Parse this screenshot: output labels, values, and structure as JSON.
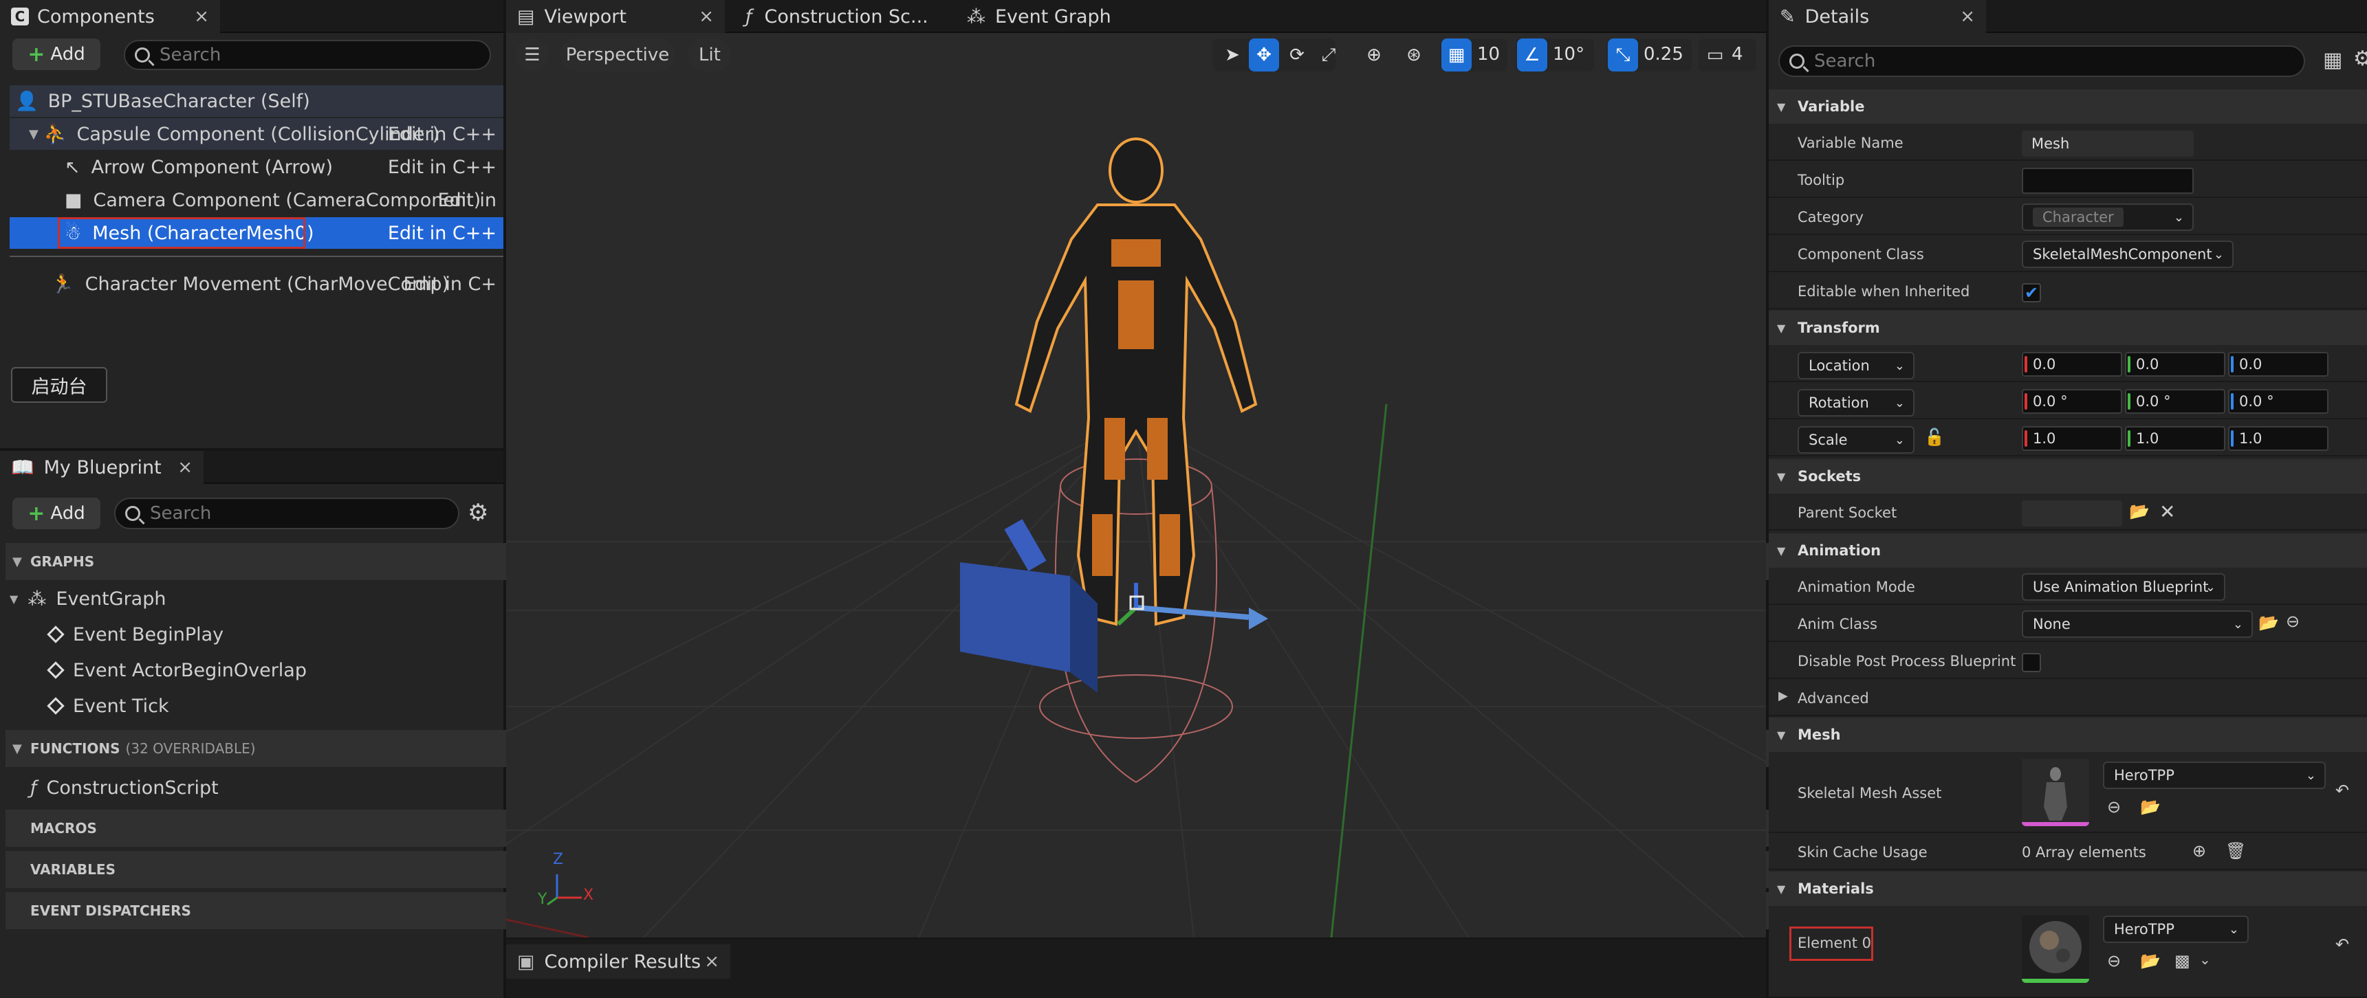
{
  "components_panel": {
    "tab_title": "Components",
    "tab_close": "×",
    "add_label": "Add",
    "search_placeholder": "Search",
    "tree": [
      {
        "label": "BP_STUBaseCharacter (Self)",
        "edit": ""
      },
      {
        "label": "Capsule Component (CollisionCylinder)",
        "edit": "Edit in C++"
      },
      {
        "label": "Arrow Component (Arrow)",
        "edit": "Edit in C++"
      },
      {
        "label": "Camera Component (CameraComponent)",
        "edit": "Edit in"
      },
      {
        "label": "Mesh (CharacterMesh0)",
        "edit": "Edit in C++"
      },
      {
        "label": "Character Movement (CharMoveComp)",
        "edit": "Edit in C+"
      }
    ],
    "launchpad_label": "启动台"
  },
  "my_blueprint": {
    "tab_title": "My Blueprint",
    "tab_close": "×",
    "add_label": "Add",
    "search_placeholder": "Search",
    "sections": {
      "graphs": "GRAPHS",
      "functions": "FUNCTIONS",
      "functions_count": "(32 OVERRIDABLE)",
      "macros": "MACROS",
      "variables": "VARIABLES",
      "event_dispatchers": "EVENT DISPATCHERS"
    },
    "graph_name": "EventGraph",
    "events": [
      "Event BeginPlay",
      "Event ActorBeginOverlap",
      "Event Tick"
    ],
    "function_name": "ConstructionScript"
  },
  "editor_tabs": [
    {
      "label": "Viewport",
      "close": "×"
    },
    {
      "label": "Construction Sc...",
      "close": ""
    },
    {
      "label": "Event Graph",
      "close": ""
    }
  ],
  "viewport": {
    "perspective_label": "Perspective",
    "lit_label": "Lit",
    "grid_snap": "10",
    "rotation_snap": "10°",
    "scale_snap": "0.25",
    "camera_speed": "4",
    "axis_labels": {
      "z": "Z",
      "y": "Y",
      "x": "X"
    }
  },
  "compiler_results": {
    "tab_title": "Compiler Results",
    "close": "×"
  },
  "details": {
    "tab_title": "Details",
    "tab_close": "×",
    "search_placeholder": "Search",
    "variable_section": "Variable",
    "variable_name_label": "Variable Name",
    "variable_name_value": "Mesh",
    "tooltip_label": "Tooltip",
    "tooltip_value": "",
    "category_label": "Category",
    "category_value": "Character",
    "component_class_label": "Component Class",
    "component_class_value": "SkeletalMeshComponent",
    "editable_label": "Editable when Inherited",
    "editable_checked": true,
    "transform_section": "Transform",
    "location_label": "Location",
    "location": [
      "0.0",
      "0.0",
      "0.0"
    ],
    "rotation_label": "Rotation",
    "rotation": [
      "0.0 °",
      "0.0 °",
      "0.0 °"
    ],
    "scale_label": "Scale",
    "scale": [
      "1.0",
      "1.0",
      "1.0"
    ],
    "sockets_section": "Sockets",
    "parent_socket_label": "Parent Socket",
    "animation_section": "Animation",
    "animation_mode_label": "Animation Mode",
    "animation_mode_value": "Use Animation Blueprint",
    "anim_class_label": "Anim Class",
    "anim_class_value": "None",
    "disable_ppb_label": "Disable Post Process Blueprint",
    "advanced_label": "Advanced",
    "mesh_section": "Mesh",
    "skeletal_mesh_label": "Skeletal Mesh Asset",
    "skeletal_mesh_value": "HeroTPP",
    "skin_cache_label": "Skin Cache Usage",
    "skin_cache_value": "0 Array elements",
    "materials_section": "Materials",
    "element0_label": "Element 0",
    "element0_value": "HeroTPP"
  },
  "colors": {
    "selection": "#2166d6",
    "highlight_box": "#c8302c",
    "accent_blue": "#1d6fd6",
    "panel_bg": "#242424",
    "viewport_bg": "#2a2a2a"
  }
}
